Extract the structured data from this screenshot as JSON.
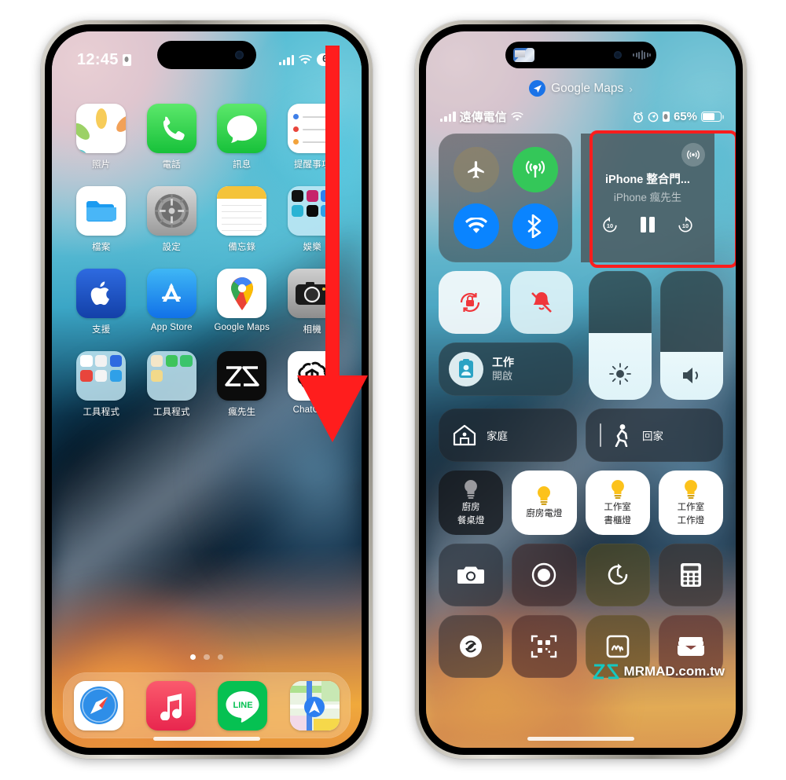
{
  "left_phone": {
    "status_bar": {
      "time": "12:45",
      "lock_icon": "portrait-orientation-lock-icon",
      "signal": "cellular-signal-icon",
      "wifi": "wifi-icon",
      "battery_percent": "68"
    },
    "apps": [
      {
        "label": "照片",
        "icon": "photos-icon"
      },
      {
        "label": "電話",
        "icon": "phone-icon"
      },
      {
        "label": "訊息",
        "icon": "messages-icon"
      },
      {
        "label": "提醒事項",
        "icon": "reminders-icon"
      },
      {
        "label": "檔案",
        "icon": "files-icon"
      },
      {
        "label": "設定",
        "icon": "settings-icon"
      },
      {
        "label": "備忘錄",
        "icon": "notes-icon"
      },
      {
        "label": "娛樂",
        "icon": "folder-icon"
      },
      {
        "label": "支援",
        "icon": "apple-support-icon"
      },
      {
        "label": "App Store",
        "icon": "app-store-icon"
      },
      {
        "label": "Google Maps",
        "icon": "google-maps-icon"
      },
      {
        "label": "相機",
        "icon": "camera-icon"
      },
      {
        "label": "工具程式",
        "icon": "folder-icon"
      },
      {
        "label": "工具程式",
        "icon": "folder-icon"
      },
      {
        "label": "瘋先生",
        "icon": "mrmad-icon"
      },
      {
        "label": "ChatGPT",
        "icon": "chatgpt-icon"
      }
    ],
    "page_dots": {
      "count": 3,
      "active": 1
    },
    "dock": [
      {
        "label": "Safari",
        "icon": "safari-icon"
      },
      {
        "label": "音樂",
        "icon": "music-icon"
      },
      {
        "label": "LINE",
        "icon": "line-icon"
      },
      {
        "label": "地圖",
        "icon": "apple-maps-icon"
      }
    ],
    "annotation": {
      "type": "swipe-down-arrow",
      "color": "#ff1d1d"
    }
  },
  "right_phone": {
    "now_playing_app": {
      "label": "Google Maps",
      "chevron": "›"
    },
    "status_bar": {
      "carrier": "遠傳電信",
      "battery_percent": "65%",
      "alarm_icon": "alarm-icon",
      "location_icon": "location-icon",
      "lock_icon": "orientation-lock-icon"
    },
    "connectivity": [
      {
        "name": "airplane-mode",
        "icon": "airplane-icon",
        "state": "off"
      },
      {
        "name": "cellular-data",
        "icon": "cellular-tower-icon",
        "state": "on"
      },
      {
        "name": "wifi",
        "icon": "wifi-icon",
        "state": "on"
      },
      {
        "name": "bluetooth",
        "icon": "bluetooth-icon",
        "state": "on"
      }
    ],
    "media": {
      "title": "iPhone 整合門...",
      "subtitle": "iPhone 瘋先生",
      "airplay_icon": "airplay-audio-icon",
      "skip_back": "10",
      "skip_forward": "10",
      "playback_state": "playing",
      "highlight_color": "#ff1d1d"
    },
    "toggles": [
      {
        "name": "rotation-lock",
        "icon": "rotation-lock-icon",
        "state": "on"
      },
      {
        "name": "silent-mode",
        "icon": "bell-slash-icon",
        "state": "on"
      }
    ],
    "focus": {
      "title": "工作",
      "state": "開啟",
      "icon": "focus-work-icon"
    },
    "sliders": [
      {
        "name": "brightness",
        "icon": "brightness-icon",
        "value": 52
      },
      {
        "name": "volume",
        "icon": "volume-icon",
        "value": 37
      }
    ],
    "home_tiles": [
      {
        "label": "家庭",
        "icon": "home-house-icon"
      },
      {
        "label": "回家",
        "icon": "walking-person-icon"
      }
    ],
    "lights": [
      {
        "label": "廚房\n餐桌燈",
        "line1": "廚房",
        "line2": "餐桌燈",
        "state": "off"
      },
      {
        "label": "廚房電燈",
        "line1": "廚房電燈",
        "line2": "",
        "state": "on"
      },
      {
        "label": "工作室\n書櫃燈",
        "line1": "工作室",
        "line2": "書櫃燈",
        "state": "on"
      },
      {
        "label": "工作室\n工作燈",
        "line1": "工作室",
        "line2": "工作燈",
        "state": "on"
      }
    ],
    "utilities_row1": [
      {
        "name": "camera",
        "icon": "camera-icon"
      },
      {
        "name": "screen-record",
        "icon": "screen-record-icon"
      },
      {
        "name": "timer",
        "icon": "timer-icon"
      },
      {
        "name": "calculator",
        "icon": "calculator-icon"
      }
    ],
    "utilities_row2": [
      {
        "name": "shazam",
        "icon": "shazam-icon"
      },
      {
        "name": "qr-scanner",
        "icon": "qr-code-icon"
      },
      {
        "name": "music-memos",
        "icon": "music-app-icon"
      },
      {
        "name": "wallet",
        "icon": "wallet-icon"
      }
    ]
  },
  "watermark": {
    "text": "MRMAD.com.tw",
    "logo": "mrmad-logo-icon"
  }
}
